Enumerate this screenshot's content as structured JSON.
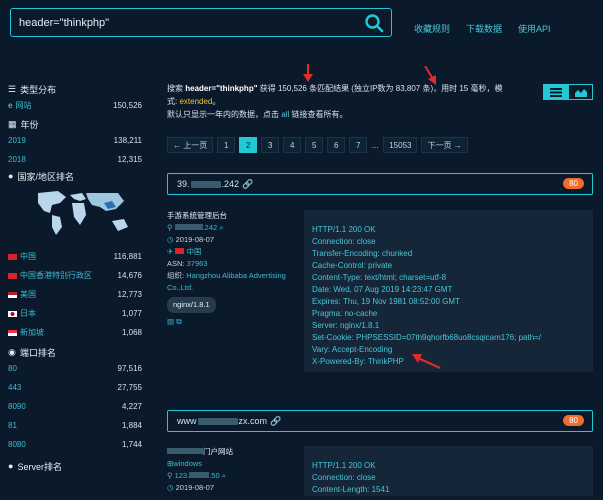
{
  "search": {
    "value": "header=\"thinkphp\""
  },
  "toplinks": [
    "收藏规则",
    "下载数据",
    "使用API"
  ],
  "sidebar": {
    "type_title": "类型分布",
    "types": [
      {
        "label": "网站",
        "count": "150,526"
      }
    ],
    "year_title": "年份",
    "years": [
      {
        "label": "2019",
        "count": "138,211"
      },
      {
        "label": "2018",
        "count": "12,315"
      }
    ],
    "country_title": "国家/地区排名",
    "countries": [
      {
        "label": "中国",
        "count": "116,881"
      },
      {
        "label": "中国香港特别行政区",
        "count": "14,676"
      },
      {
        "label": "美国",
        "count": "12,773"
      },
      {
        "label": "日本",
        "count": "1,077"
      },
      {
        "label": "新加坡",
        "count": "1,068"
      }
    ],
    "port_title": "端口排名",
    "ports": [
      {
        "label": "80",
        "count": "97,516"
      },
      {
        "label": "443",
        "count": "27,755"
      },
      {
        "label": "8090",
        "count": "4,227"
      },
      {
        "label": "81",
        "count": "1,884"
      },
      {
        "label": "8080",
        "count": "1,744"
      }
    ],
    "server_title": "Server排名"
  },
  "summary": {
    "prefix": "搜索 ",
    "query": "header=\"thinkphp\"",
    "mid1": " 获得 150,526 条匹配结果 (独立IP数为 83,807 条)，用时 15 毫秒，模式: ",
    "mode": "extended",
    "mid2": "。",
    "line3a": "默认只显示一年内的数据，点击 ",
    "all": "all",
    "line3b": " 链接查看所有。"
  },
  "pager": {
    "prev": "← 上一页",
    "pages": [
      "1",
      "2",
      "3",
      "4",
      "5",
      "6",
      "7"
    ],
    "dots": "...",
    "last": "15053",
    "next": "下一页 →"
  },
  "results": [
    {
      "host_a": "39.",
      "host_b": ".242",
      "score": "80",
      "title": "手游系统管理后台",
      "ip_suffix": ".242",
      "date": "2019-08-07",
      "country": "中国",
      "asn_label": "ASN:",
      "asn": "37963",
      "org_label": "组织:",
      "org": "Hangzhou Alibaba Advertising Co.,Ltd.",
      "server": "nginx/1.8.1",
      "headers": [
        "HTTP/1.1 200 OK",
        "Connection: close",
        "Transfer-Encoding: chunked",
        "Cache-Control: private",
        "Content-Type: text/html; charset=utf-8",
        "Date: Wed, 07 Aug 2019 14:23:47 GMT",
        "Expires: Thu, 19 Nov 1981 08:52:00 GMT",
        "Pragma: no-cache",
        "Server: nginx/1.8.1",
        "Set-Cookie: PHPSESSID=07th9qhorfb68uo8csqicam176; path=/",
        "Vary: Accept-Encoding",
        "X-Powered-By: ThinkPHP"
      ]
    },
    {
      "host_a": "www",
      "host_b": "zx.com",
      "score": "80",
      "title": "门户网站",
      "os": "windows",
      "ip_prefix": "123.",
      "ip_suffix": ".50",
      "date": "2019-08-07",
      "headers": [
        "HTTP/1.1 200 OK",
        "Connection: close",
        "Content-Length: 1541"
      ]
    }
  ],
  "colors": {
    "accent": "#22c8d4",
    "badge": "#ef6c2a",
    "bg": "#0b1a2b",
    "arrow": "#e02b2b"
  }
}
